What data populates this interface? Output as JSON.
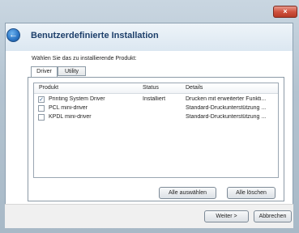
{
  "window": {
    "close_label": "×",
    "title": "Benutzerdefinierte Installation"
  },
  "prompt": "Wählen Sie das zu installierende Produkt:",
  "tabs": [
    {
      "label": "Driver",
      "active": true
    },
    {
      "label": "Utility",
      "active": false
    }
  ],
  "table": {
    "headers": [
      "Produkt",
      "Status",
      "Details"
    ],
    "rows": [
      {
        "checked": true,
        "product": "Printing System Driver",
        "status": "Installiert",
        "details": "Drucken mit erweiterter Funkti..."
      },
      {
        "checked": false,
        "product": "PCL mini-driver",
        "status": "",
        "details": "Standard-Druckunterstützung ..."
      },
      {
        "checked": false,
        "product": "KPDL mini-driver",
        "status": "",
        "details": "Standard-Druckunterstützung ..."
      }
    ]
  },
  "buttons": {
    "select_all": "Alle auswählen",
    "clear_all": "Alle löschen",
    "next": "Weiter >",
    "cancel": "Abbrechen"
  },
  "icons": {
    "back": "back-arrow-icon",
    "check": "check-icon"
  }
}
